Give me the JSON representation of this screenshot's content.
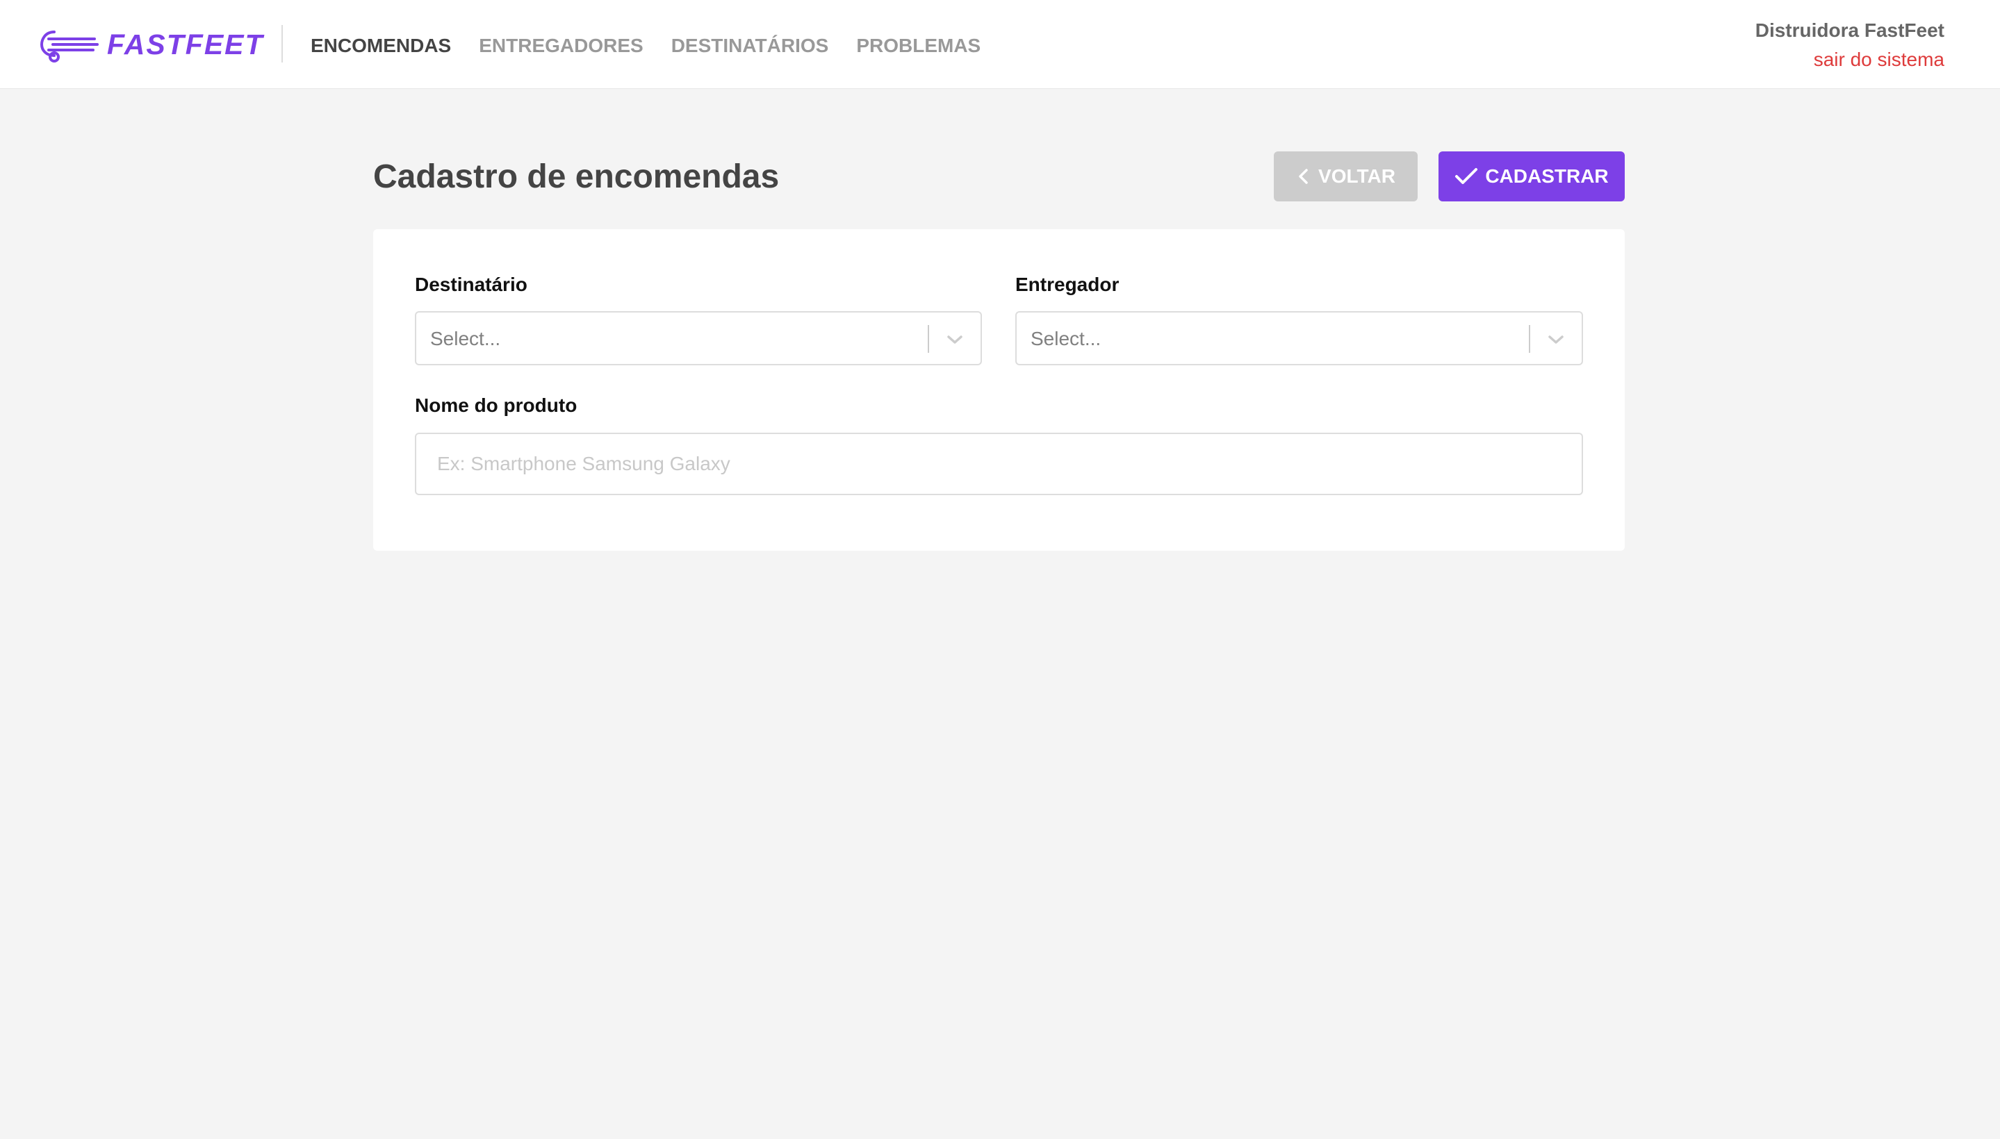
{
  "brand": {
    "name": "FASTFEET",
    "logo_icon": "truck-speed-icon",
    "color": "#7d40e7"
  },
  "nav": {
    "items": [
      {
        "label": "ENCOMENDAS",
        "active": true
      },
      {
        "label": "ENTREGADORES",
        "active": false
      },
      {
        "label": "DESTINATÁRIOS",
        "active": false
      },
      {
        "label": "PROBLEMAS",
        "active": false
      }
    ]
  },
  "user": {
    "company": "Distruidora FastFeet",
    "logout_label": "sair do sistema",
    "logout_color": "#de3b3b"
  },
  "page": {
    "title": "Cadastro de encomendas"
  },
  "actions": {
    "back": {
      "label": "VOLTAR",
      "icon": "chevron-left-icon",
      "color": "#cccccc"
    },
    "save": {
      "label": "CADASTRAR",
      "icon": "check-icon",
      "color": "#7d40e7"
    }
  },
  "form": {
    "recipient": {
      "label": "Destinatário",
      "placeholder": "Select...",
      "icon": "chevron-down-icon"
    },
    "deliveryman": {
      "label": "Entregador",
      "placeholder": "Select...",
      "icon": "chevron-down-icon"
    },
    "product": {
      "label": "Nome do produto",
      "placeholder": "Ex: Smartphone Samsung Galaxy",
      "value": ""
    }
  }
}
